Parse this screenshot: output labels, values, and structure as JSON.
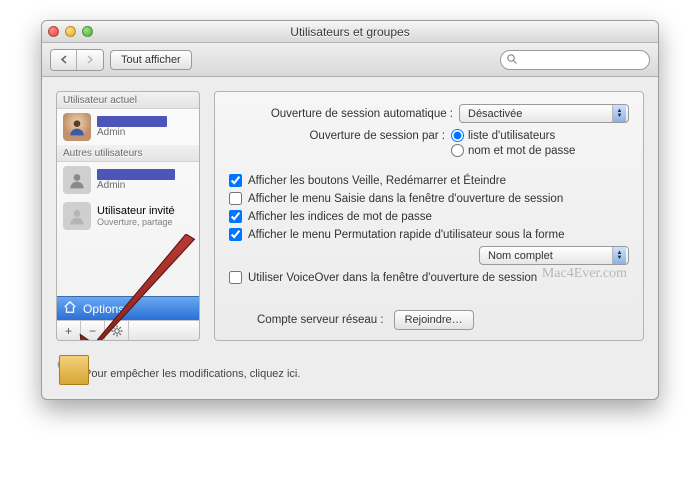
{
  "window": {
    "title": "Utilisateurs et groupes"
  },
  "toolbar": {
    "show_all_label": "Tout afficher",
    "search_placeholder": ""
  },
  "sidebar": {
    "section_current": "Utilisateur actuel",
    "section_other": "Autres utilisateurs",
    "current_user": {
      "role": "Admin"
    },
    "other_user": {
      "role": "Admin"
    },
    "guest": {
      "name": "Utilisateur invité",
      "sub": "Ouverture, partage"
    },
    "options_label": "Options"
  },
  "content": {
    "auto_login_label": "Ouverture de session automatique :",
    "auto_login_value": "Désactivée",
    "login_by_label": "Ouverture de session par :",
    "radio_user_list": "liste d'utilisateurs",
    "radio_name_pw": "nom et mot de passe",
    "chk_sleep": "Afficher les boutons Veille, Redémarrer et Éteindre",
    "chk_input": "Afficher le menu Saisie dans la fenêtre d'ouverture de session",
    "chk_hints": "Afficher les indices de mot de passe",
    "chk_fastswitch": "Afficher le menu Permutation rapide d'utilisateur sous la forme",
    "fastswitch_value": "Nom complet",
    "chk_voiceover": "Utiliser VoiceOver dans la fenêtre d'ouverture de session",
    "net_server_label": "Compte serveur réseau :",
    "join_btn": "Rejoindre…",
    "watermark": "Mac4Ever.com"
  },
  "lock": {
    "text": "Pour empêcher les modifications, cliquez ici."
  }
}
